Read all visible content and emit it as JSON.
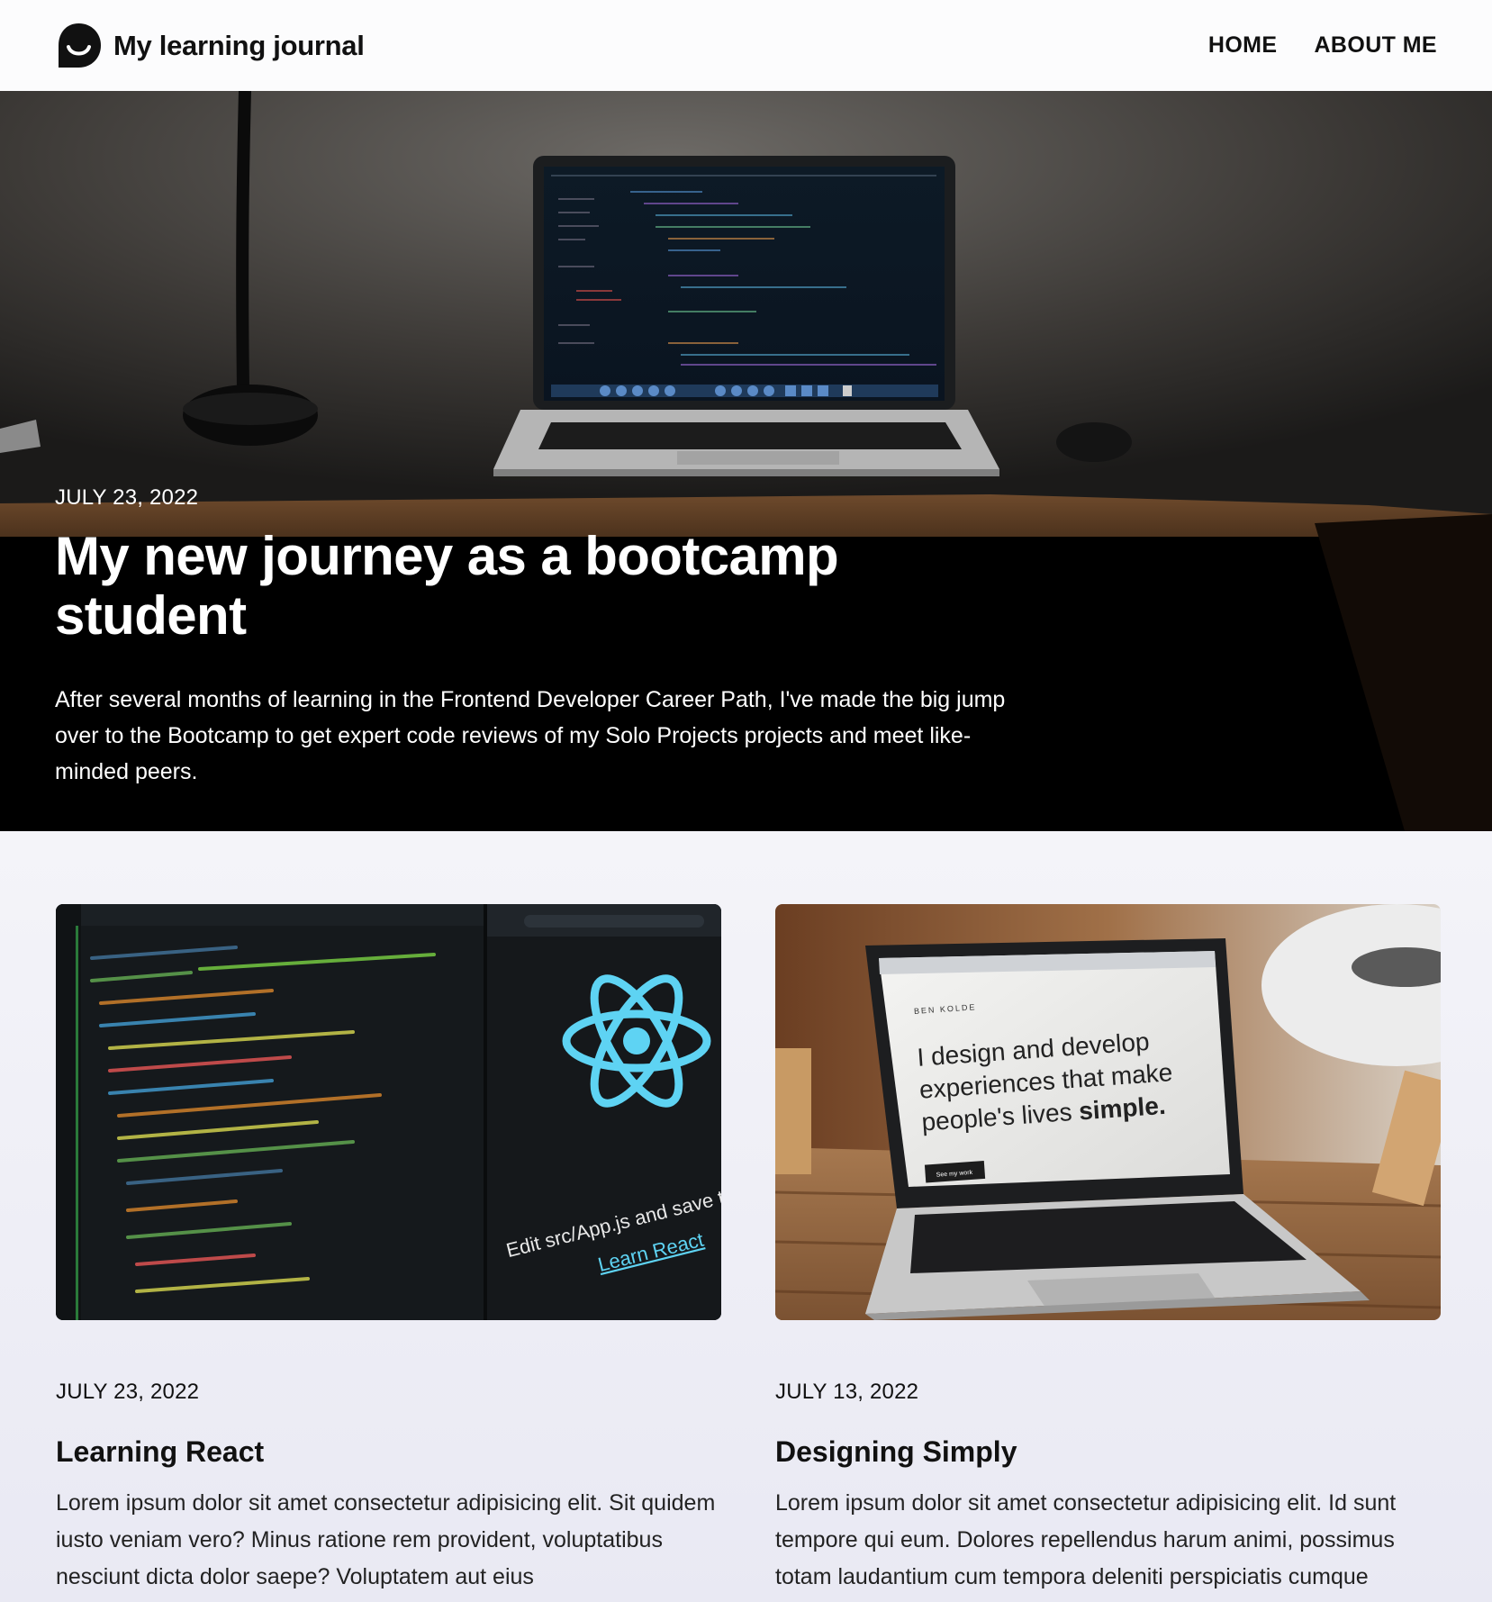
{
  "header": {
    "logo_icon": "chat-bubble-smile-icon",
    "brand_name": "My learning journal",
    "nav": [
      {
        "label": "HOME"
      },
      {
        "label": "ABOUT ME"
      }
    ]
  },
  "hero": {
    "image": "desk-laptop-photo",
    "date": "JULY 23, 2022",
    "title": "My new journey as a bootcamp student",
    "text": "After several months of learning in the Frontend Developer Career Path, I've made the big jump over to the Bootcamp to get expert code reviews of my Solo Projects projects and meet like-minded peers."
  },
  "posts": [
    {
      "image": "react-code-screen-photo",
      "image_text": {
        "line1": "Edit src/App.js and save to rel",
        "link": "Learn React"
      },
      "date": "JULY 23, 2022",
      "title": "Learning React",
      "text": "Lorem ipsum dolor sit amet consectetur adipisicing elit. Sit quidem iusto veniam vero? Minus ratione rem provident, voluptatibus nesciunt dicta dolor saepe? Voluptatem aut eius"
    },
    {
      "image": "laptop-on-table-photo",
      "image_text": {
        "site": "BEN KOLDE",
        "line1": "I design and develop",
        "line2": "experiences that make",
        "line3": "people's lives",
        "line3_bold": "simple.",
        "button": "See my work"
      },
      "date": "JULY 13, 2022",
      "title": "Designing Simply",
      "text": "Lorem ipsum dolor sit amet consectetur adipisicing elit. Id sunt tempore qui eum. Dolores repellendus harum animi, possimus totam laudantium cum tempora deleniti perspiciatis cumque"
    }
  ],
  "colors": {
    "page_bg": "#ececf4",
    "header_bg": "#fcfcfd",
    "hero_bg": "#000000",
    "text": "#111111",
    "react_cyan": "#5ed3f3"
  }
}
